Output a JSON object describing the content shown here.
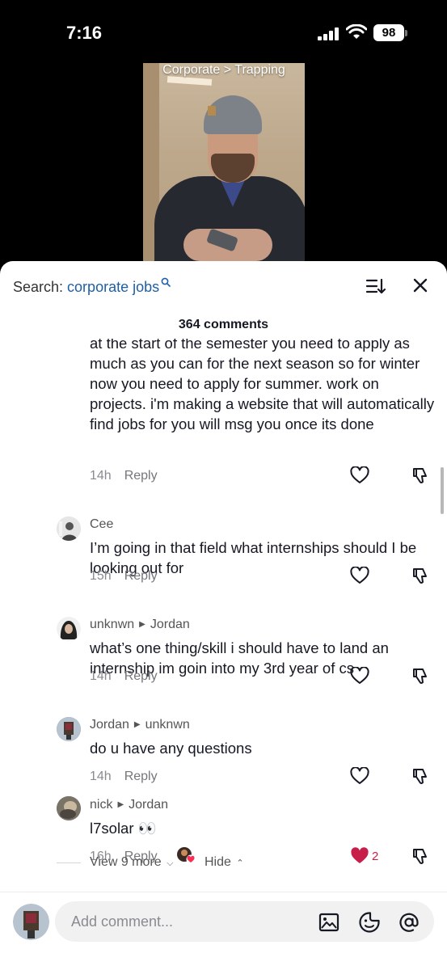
{
  "status_bar": {
    "time": "7:16",
    "battery": "98"
  },
  "video": {
    "caption": "Corporate > Trapping"
  },
  "search": {
    "prefix": "Search: ",
    "keyword": "corporate jobs"
  },
  "comments_count": "364 comments",
  "partial_comment": {
    "text": "at the start of the semester you need to apply as much as you can for the next season so for winter now you need to apply for summer. work on projects. i'm making a website that will automatically find jobs for you will msg you once its done",
    "time": "14h",
    "reply": "Reply"
  },
  "comments": [
    {
      "user": "Cee",
      "reply_to": "",
      "text": "I’m going in that field what internships should I be looking out for",
      "time": "15h",
      "reply": "Reply"
    },
    {
      "user": "unknwn",
      "reply_to": "Jordan",
      "text": "what’s one thing/skill i should have to land an internship im goin into my 3rd year of cs",
      "time": "14h",
      "reply": "Reply"
    },
    {
      "user": "Jordan",
      "reply_to": "unknwn",
      "text": "do u have any questions",
      "time": "14h",
      "reply": "Reply"
    },
    {
      "user": "nick",
      "reply_to": "Jordan",
      "text": "l7solar 👀",
      "time": "16h",
      "reply": "Reply",
      "likes": "2"
    }
  ],
  "view_more": "View 9 more",
  "hide": "Hide",
  "input": {
    "placeholder": "Add comment..."
  },
  "colors": {
    "link": "#1f5fa8",
    "like_red": "#c81f4a",
    "text": "#161823",
    "muted": "#8a8b91"
  },
  "icons": [
    "signal-icon",
    "wifi-icon",
    "sort-icon",
    "close-icon",
    "heart-icon",
    "dislike-icon",
    "photo-icon",
    "emoji-icon",
    "at-icon",
    "search-icon"
  ]
}
